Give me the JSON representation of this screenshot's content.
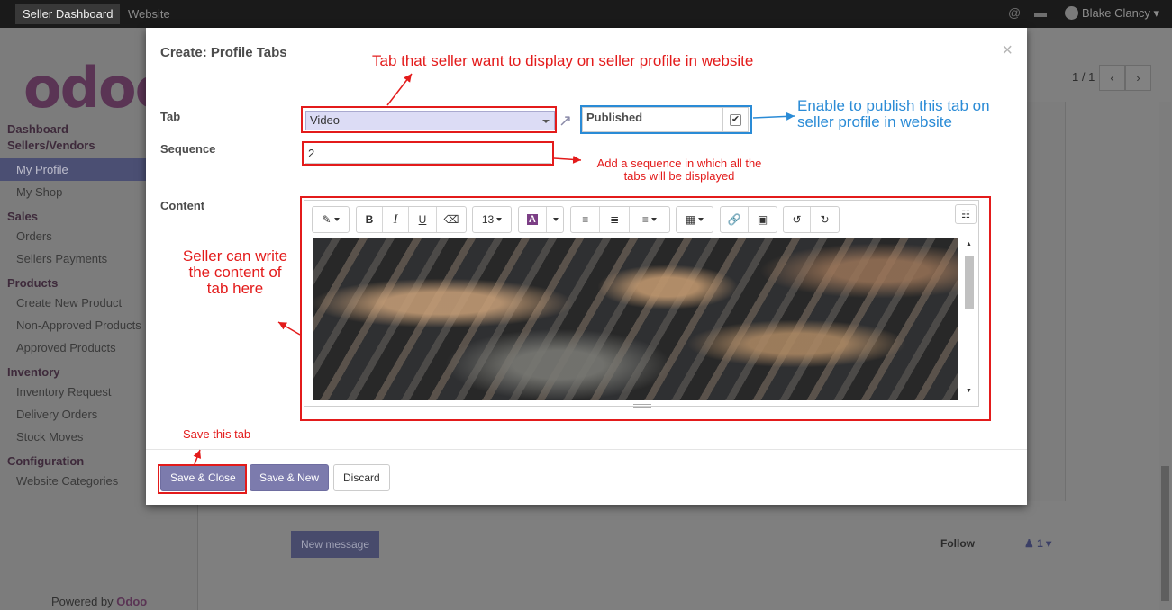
{
  "topbar": {
    "apps": [
      "Seller Dashboard",
      "Website"
    ],
    "user": "Blake Clancy"
  },
  "sidebar": {
    "logo": "odoo",
    "sections": [
      {
        "title": "Dashboard",
        "items": []
      },
      {
        "title": "Sellers/Vendors",
        "items": [
          "My Profile",
          "My Shop"
        ]
      },
      {
        "title": "Sales",
        "items": [
          "Orders",
          "Sellers Payments"
        ]
      },
      {
        "title": "Products",
        "items": [
          "Create New Product",
          "Non-Approved Products",
          "Approved Products"
        ]
      },
      {
        "title": "Inventory",
        "items": [
          "Inventory Request",
          "Delivery Orders",
          "Stock Moves"
        ]
      },
      {
        "title": "Configuration",
        "items": [
          "Website Categories"
        ]
      }
    ],
    "active_item": "My Profile",
    "powered_prefix": "Powered by ",
    "powered_brand": "Odoo"
  },
  "background": {
    "pager": "1 / 1",
    "new_message": "New message",
    "follow": "Follow",
    "followers": "1"
  },
  "modal": {
    "title": "Create: Profile Tabs",
    "close": "×",
    "fields": {
      "tab_label": "Tab",
      "tab_value": "Video",
      "published_label": "Published",
      "published_checked": true,
      "sequence_label": "Sequence",
      "sequence_value": "2",
      "content_label": "Content"
    },
    "editor": {
      "font_size": "13",
      "toolbar_icons": [
        "magic-wand-icon",
        "bold-icon",
        "italic-icon",
        "underline-icon",
        "eraser-icon",
        "font-size-dropdown",
        "text-color-icon",
        "bullet-list-icon",
        "numbered-list-icon",
        "align-icon",
        "table-icon",
        "link-icon",
        "image-icon",
        "undo-icon",
        "redo-icon",
        "translate-icon"
      ]
    },
    "buttons": {
      "save_close": "Save & Close",
      "save_new": "Save & New",
      "discard": "Discard"
    }
  },
  "annotations": {
    "tab_note": "Tab  that seller want to display on seller profile in website",
    "publish_note_1": "Enable to publish this tab on",
    "publish_note_2": "seller profile in website",
    "sequence_note_1": "Add a sequence in which all the",
    "sequence_note_2": "tabs will be displayed",
    "content_note_1": "Seller can write",
    "content_note_2": "the content of",
    "content_note_3": "tab here",
    "save_note": "Save this tab",
    "colors": {
      "red": "#e31b1b",
      "blue": "#2a8bd6"
    }
  }
}
